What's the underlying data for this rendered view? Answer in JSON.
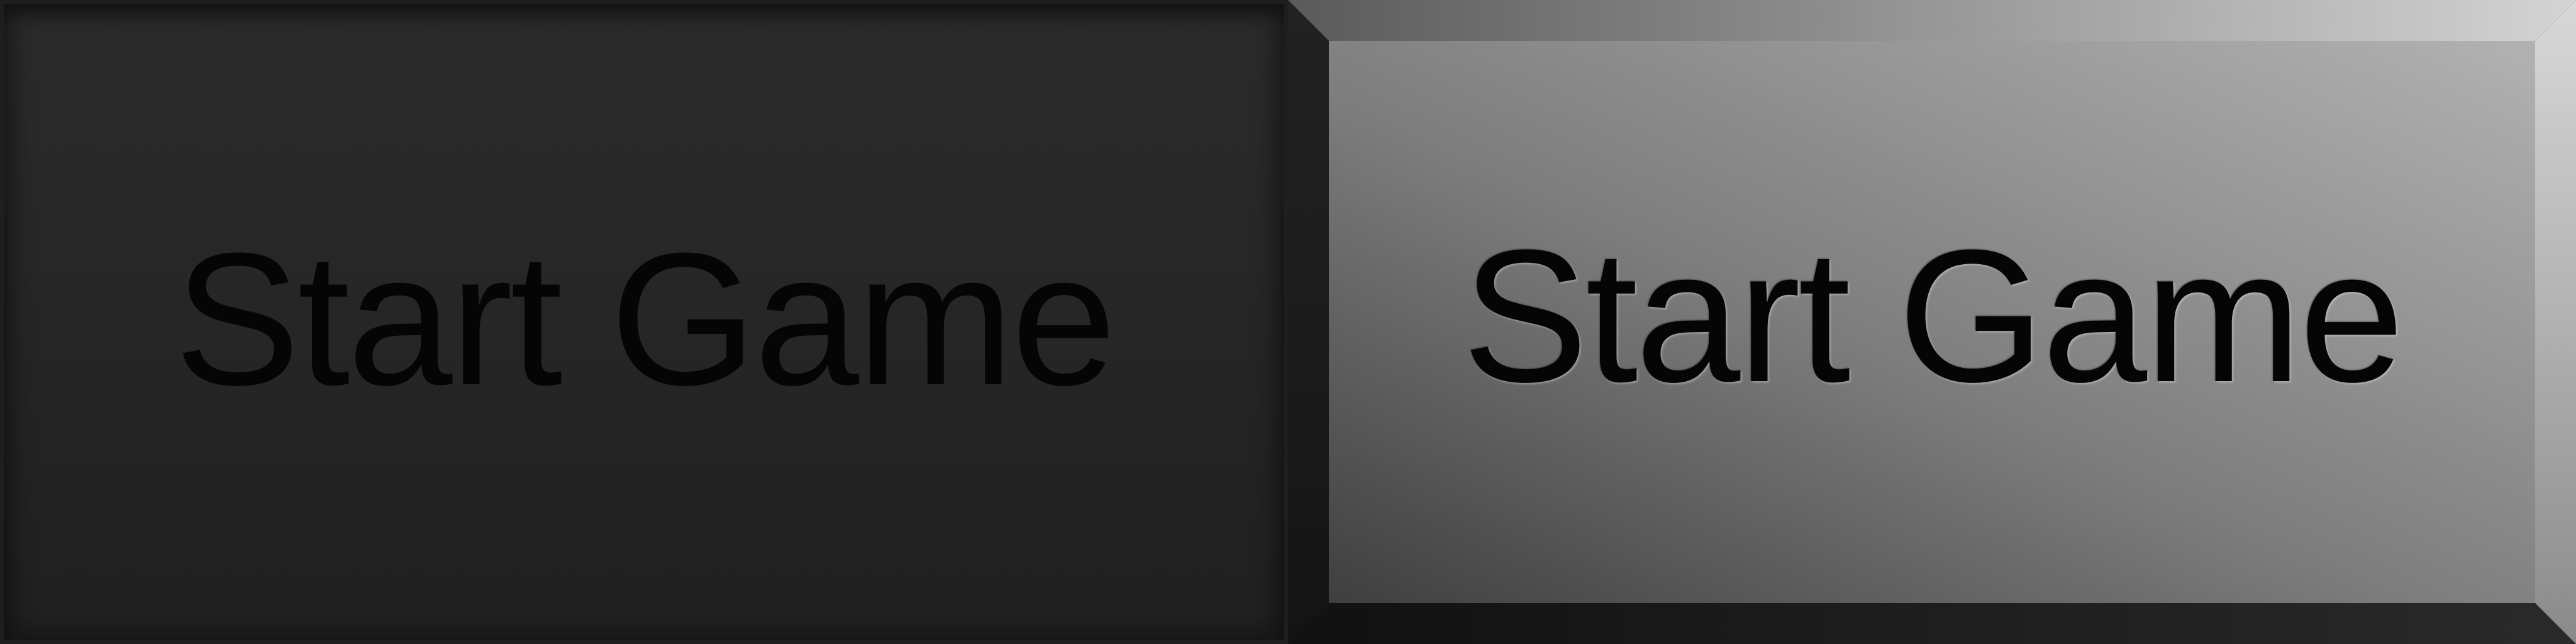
{
  "buttons": {
    "pressed": {
      "label": "Start Game",
      "state": "pressed"
    },
    "normal": {
      "label": "Start Game",
      "state": "normal"
    }
  },
  "colors": {
    "pressed_face": "#272727",
    "raised_face_dark": "#555555",
    "raised_face_light": "#aaaaaa",
    "text": "#050505"
  }
}
